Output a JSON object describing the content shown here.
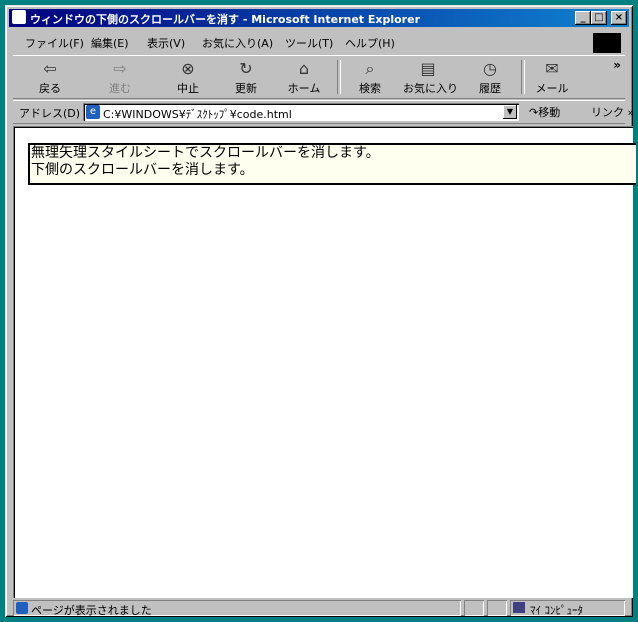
{
  "window": {
    "title": "ウィンドウの下側のスクロールバーを消す - Microsoft Internet Explorer",
    "minimize_label": "_",
    "maximize_label": "□",
    "close_label": "×"
  },
  "menu": [
    "ファイル(F)",
    "編集(E)",
    "表示(V)",
    "お気に入り(A)",
    "ツール(T)",
    "ヘルプ(H)"
  ],
  "toolbar": {
    "back": "戻る",
    "forward": "進む",
    "stop": "中止",
    "refresh": "更新",
    "home": "ホーム",
    "search": "検索",
    "favorites": "お気に入り",
    "history": "履歴",
    "mail": "メール",
    "more": "»"
  },
  "address": {
    "label": "アドレス(D)",
    "value": "C:¥WINDOWS¥ﾃﾞｽｸﾄｯﾌﾟ¥code.html",
    "go": "移動",
    "links": "リンク »"
  },
  "content": {
    "line1": "無理矢理スタイルシートでスクロールバーを消します。",
    "line2": "下側のスクロールバーを消します。"
  },
  "status": {
    "text": "ページが表示されました",
    "zone": "ﾏｲ ｺﾝﾋﾟｭｰﾀ"
  },
  "colors": {
    "desktop": "#008080",
    "titlebar": "#000080",
    "message_bg": "#fffff0"
  }
}
